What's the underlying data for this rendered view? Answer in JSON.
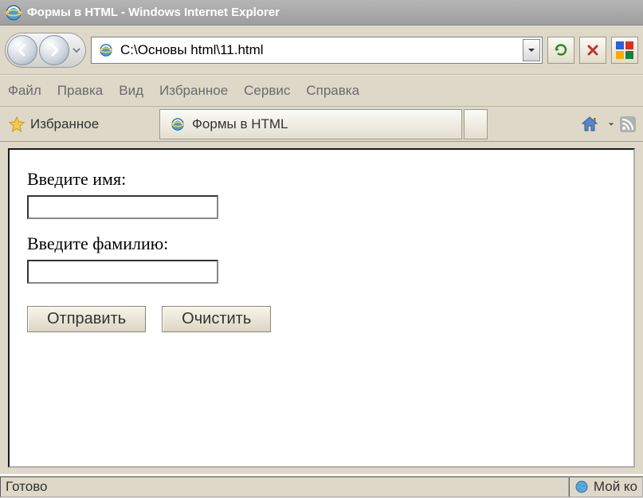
{
  "window": {
    "title": "Формы в HTML - Windows Internet Explorer"
  },
  "address": {
    "value": "C:\\Основы html\\11.html"
  },
  "menu": {
    "file": "Файл",
    "edit": "Правка",
    "view": "Вид",
    "favorites": "Избранное",
    "tools": "Сервис",
    "help": "Справка"
  },
  "favbar": {
    "label": "Избранное",
    "tab_title": "Формы в HTML"
  },
  "form": {
    "name_label": "Введите имя:",
    "surname_label": "Введите фамилию:",
    "name_value": "",
    "surname_value": "",
    "submit": "Отправить",
    "reset": "Очистить"
  },
  "status": {
    "ready": "Готово",
    "zone": "Мой ко"
  }
}
